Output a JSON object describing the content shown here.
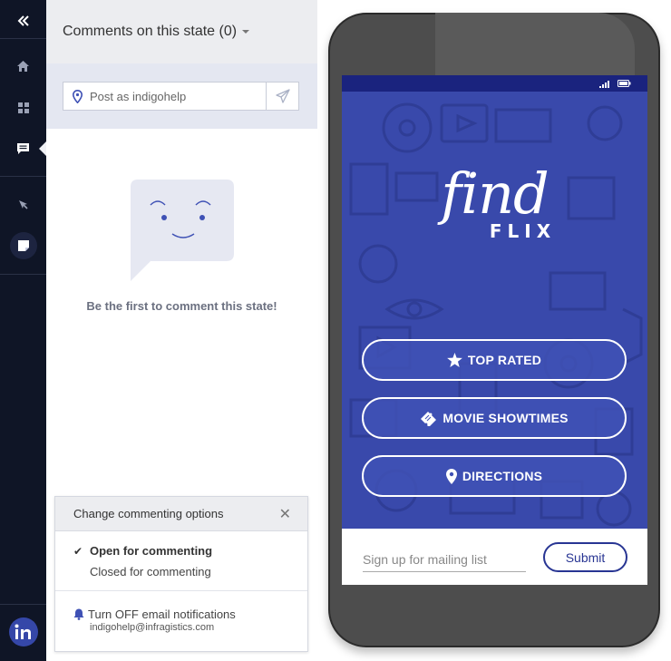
{
  "rail": {
    "items": [
      {
        "name": "collapse",
        "icon": "double-chevron-left-icon"
      },
      {
        "name": "home",
        "icon": "home-icon"
      },
      {
        "name": "screens",
        "icon": "grid-icon"
      },
      {
        "name": "comments",
        "icon": "comment-icon",
        "active": true
      },
      {
        "name": "inspect",
        "icon": "pointer-icon"
      },
      {
        "name": "notes",
        "icon": "note-icon"
      }
    ],
    "logo": "logo-icon"
  },
  "comments": {
    "title": "Comments on this state (0)",
    "post_placeholder": "Post as indigohelp",
    "empty_message": "Be the first to comment this state!"
  },
  "options": {
    "title": "Change commenting options",
    "open_label": "Open for commenting",
    "closed_label": "Closed for commenting",
    "notify_label": "Turn OFF email notifications",
    "email": "indigohelp@infragistics.com"
  },
  "app": {
    "brand_script": "find",
    "brand_word": "FLIX",
    "buttons": [
      {
        "label": "TOP RATED",
        "icon": "star-icon"
      },
      {
        "label": "MOVIE SHOWTIMES",
        "icon": "ticket-icon"
      },
      {
        "label": "DIRECTIONS",
        "icon": "map-pin-icon"
      }
    ],
    "signup_placeholder": "Sign up for mailing list",
    "submit_label": "Submit"
  },
  "colors": {
    "rail_bg": "#0f1526",
    "app_blue": "#3949ab",
    "app_dark": "#1a237e",
    "accent": "#283593"
  }
}
